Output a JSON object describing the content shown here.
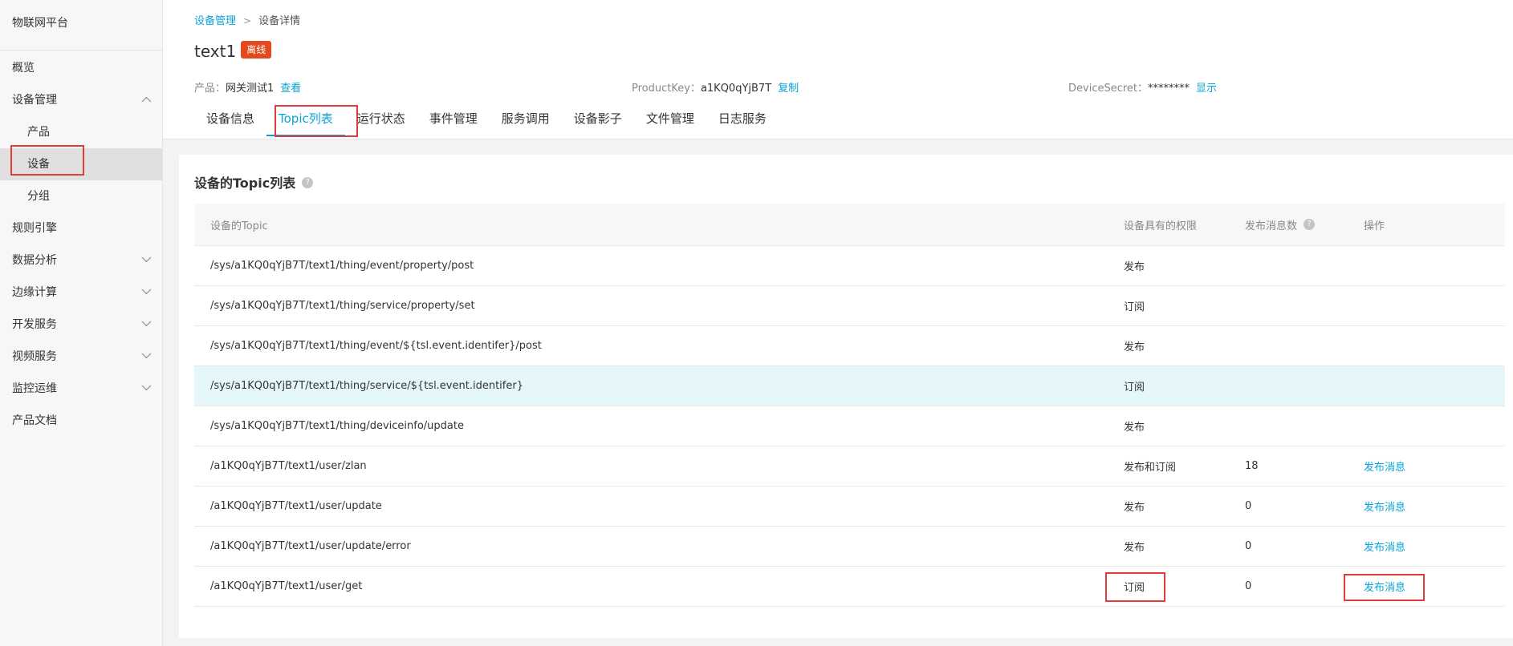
{
  "sidebar": {
    "brand": "物联网平台",
    "items": [
      {
        "label": "概览"
      },
      {
        "label": "设备管理"
      },
      {
        "label": "产品"
      },
      {
        "label": "设备"
      },
      {
        "label": "分组"
      },
      {
        "label": "规则引擎"
      },
      {
        "label": "数据分析"
      },
      {
        "label": "边缘计算"
      },
      {
        "label": "开发服务"
      },
      {
        "label": "视频服务"
      },
      {
        "label": "监控运维"
      },
      {
        "label": "产品文档"
      }
    ]
  },
  "breadcrumb": {
    "parent": "设备管理",
    "current": "设备详情"
  },
  "device": {
    "name": "text1",
    "status": "离线",
    "product_label": "产品：",
    "product_value": "网关测试1",
    "product_link": "查看",
    "productkey_label": "ProductKey：",
    "productkey_value": "a1KQ0qYjB7T",
    "productkey_link": "复制",
    "secret_label": "DeviceSecret：",
    "secret_value": "********",
    "secret_link": "显示"
  },
  "tabs": [
    {
      "label": "设备信息"
    },
    {
      "label": "Topic列表"
    },
    {
      "label": "运行状态"
    },
    {
      "label": "事件管理"
    },
    {
      "label": "服务调用"
    },
    {
      "label": "设备影子"
    },
    {
      "label": "文件管理"
    },
    {
      "label": "日志服务"
    }
  ],
  "section": {
    "title": "设备的Topic列表",
    "help": "?"
  },
  "table": {
    "headers": {
      "topic": "设备的Topic",
      "permission": "设备具有的权限",
      "count": "发布消息数",
      "count_help": "?",
      "action": "操作"
    },
    "rows": [
      {
        "topic": "/sys/a1KQ0qYjB7T/text1/thing/event/property/post",
        "permission": "发布",
        "count": "",
        "action": ""
      },
      {
        "topic": "/sys/a1KQ0qYjB7T/text1/thing/service/property/set",
        "permission": "订阅",
        "count": "",
        "action": ""
      },
      {
        "topic": "/sys/a1KQ0qYjB7T/text1/thing/event/${tsl.event.identifer}/post",
        "permission": "发布",
        "count": "",
        "action": ""
      },
      {
        "topic": "/sys/a1KQ0qYjB7T/text1/thing/service/${tsl.event.identifer}",
        "permission": "订阅",
        "count": "",
        "action": ""
      },
      {
        "topic": "/sys/a1KQ0qYjB7T/text1/thing/deviceinfo/update",
        "permission": "发布",
        "count": "",
        "action": ""
      },
      {
        "topic": "/a1KQ0qYjB7T/text1/user/zlan",
        "permission": "发布和订阅",
        "count": "18",
        "action": "发布消息"
      },
      {
        "topic": "/a1KQ0qYjB7T/text1/user/update",
        "permission": "发布",
        "count": "0",
        "action": "发布消息"
      },
      {
        "topic": "/a1KQ0qYjB7T/text1/user/update/error",
        "permission": "发布",
        "count": "0",
        "action": "发布消息"
      },
      {
        "topic": "/a1KQ0qYjB7T/text1/user/get",
        "permission": "订阅",
        "count": "0",
        "action": "发布消息"
      }
    ]
  }
}
